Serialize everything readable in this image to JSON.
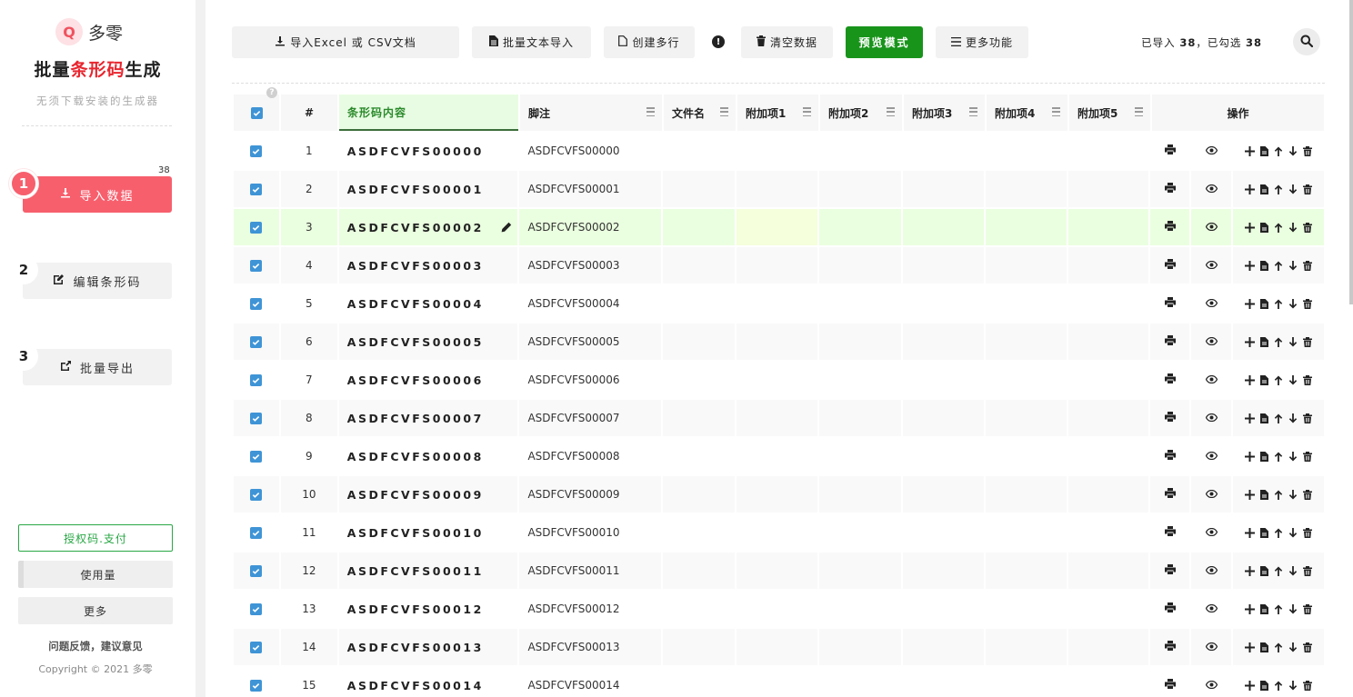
{
  "sidebar": {
    "logo_letter": "Q",
    "logo_text": "多零",
    "title_prefix": "批量",
    "title_highlight": "条形码",
    "title_suffix": "生成",
    "subtitle": "无须下载安装的生成器",
    "steps": [
      {
        "num": "1",
        "label": "导入数据",
        "icon": "download-icon"
      },
      {
        "num": "2",
        "label": "编辑条形码",
        "icon": "edit-icon"
      },
      {
        "num": "3",
        "label": "批量导出",
        "icon": "export-icon"
      }
    ],
    "step1_count": "38",
    "auth_label": "授权码.支付",
    "usage_label": "使用量",
    "more_label": "更多",
    "feedback": "问题反馈，建议意见",
    "copyright": "Copyright © 2021 多零"
  },
  "toolbar": {
    "import_excel": "导入Excel 或 CSV文档",
    "batch_text": "批量文本导入",
    "create_rows": "创建多行",
    "clear_data": "清空数据",
    "preview_mode": "预览模式",
    "more_functions": "更多功能",
    "stat_prefix": "已导入",
    "imported_count": "38",
    "stat_mid": "，已勾选",
    "checked_count": "38"
  },
  "table": {
    "headers": {
      "num": "#",
      "code": "条形码内容",
      "note": "脚注",
      "file": "文件名",
      "ext1": "附加项1",
      "ext2": "附加项2",
      "ext3": "附加项3",
      "ext4": "附加项4",
      "ext5": "附加项5",
      "ops": "操作"
    },
    "rows": [
      {
        "num": "1",
        "code": "ASDFCVFS00000",
        "note": "ASDFCVFS00000"
      },
      {
        "num": "2",
        "code": "ASDFCVFS00001",
        "note": "ASDFCVFS00001"
      },
      {
        "num": "3",
        "code": "ASDFCVFS00002",
        "note": "ASDFCVFS00002"
      },
      {
        "num": "4",
        "code": "ASDFCVFS00003",
        "note": "ASDFCVFS00003"
      },
      {
        "num": "5",
        "code": "ASDFCVFS00004",
        "note": "ASDFCVFS00004"
      },
      {
        "num": "6",
        "code": "ASDFCVFS00005",
        "note": "ASDFCVFS00005"
      },
      {
        "num": "7",
        "code": "ASDFCVFS00006",
        "note": "ASDFCVFS00006"
      },
      {
        "num": "8",
        "code": "ASDFCVFS00007",
        "note": "ASDFCVFS00007"
      },
      {
        "num": "9",
        "code": "ASDFCVFS00008",
        "note": "ASDFCVFS00008"
      },
      {
        "num": "10",
        "code": "ASDFCVFS00009",
        "note": "ASDFCVFS00009"
      },
      {
        "num": "11",
        "code": "ASDFCVFS00010",
        "note": "ASDFCVFS00010"
      },
      {
        "num": "12",
        "code": "ASDFCVFS00011",
        "note": "ASDFCVFS00011"
      },
      {
        "num": "13",
        "code": "ASDFCVFS00012",
        "note": "ASDFCVFS00012"
      },
      {
        "num": "14",
        "code": "ASDFCVFS00013",
        "note": "ASDFCVFS00013"
      },
      {
        "num": "15",
        "code": "ASDFCVFS00014",
        "note": "ASDFCVFS00014"
      }
    ],
    "selected_row": "3"
  },
  "colors": {
    "accent_red": "#f75f6d",
    "title_red": "#e8262f",
    "preview_green": "#19941b",
    "auth_green": "#28a745",
    "checkbox_blue": "#3f94d6",
    "selected_row_bg": "#eaffdf"
  }
}
